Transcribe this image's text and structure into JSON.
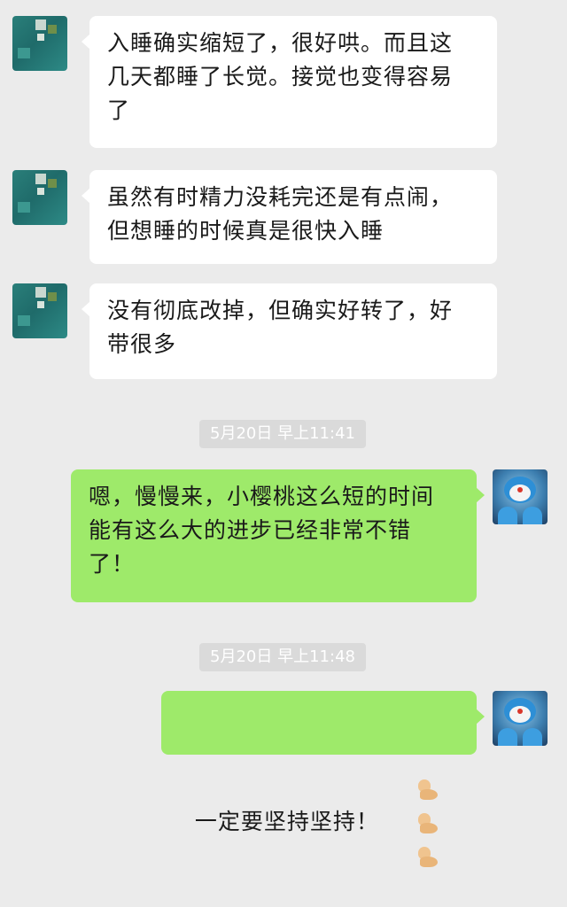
{
  "messages": [
    {
      "sender": "contact",
      "avatar_icon": "mosaic-avatar-icon",
      "text": "入睡确实缩短了，很好哄。而且这\n几天都睡了长觉。接觉也变得容易\n了"
    },
    {
      "sender": "contact",
      "avatar_icon": "mosaic-avatar-icon",
      "text": "虽然有时精力没耗完还是有点闹，\n但想睡的时候真是很快入睡"
    },
    {
      "sender": "contact",
      "avatar_icon": "mosaic-avatar-icon",
      "text": "没有彻底改掉，但确实好转了，好\n带很多"
    },
    {
      "type": "timestamp",
      "text": "5月20日 早上11:41"
    },
    {
      "sender": "me",
      "avatar_icon": "doraemon-avatar-icon",
      "text": "嗯，慢慢来，小樱桃这么短的时间\n能有这么大的进步已经非常不错\n了！"
    },
    {
      "type": "timestamp",
      "text": "5月20日 早上11:48"
    },
    {
      "sender": "me",
      "avatar_icon": "doraemon-avatar-icon",
      "text": "一定要坚持坚持！",
      "emoji": [
        "flexed-biceps-emoji",
        "flexed-biceps-emoji",
        "flexed-biceps-emoji"
      ]
    }
  ],
  "colors": {
    "background": "#ebebeb",
    "incoming_bubble": "#ffffff",
    "outgoing_bubble": "#9eea6a",
    "timestamp_bg": "#dadada",
    "timestamp_text": "#ffffff"
  }
}
